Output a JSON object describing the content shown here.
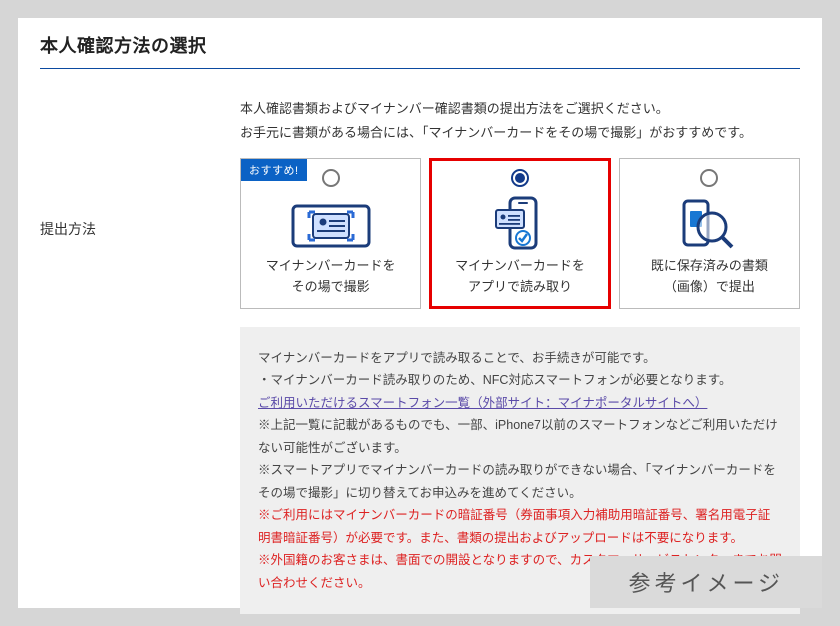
{
  "title": "本人確認方法の選択",
  "instructions": {
    "line1": "本人確認書類およびマイナンバー確認書類の提出方法をご選択ください。",
    "line2": "お手元に書類がある場合には、「マイナンバーカードをその場で撮影」がおすすめです。"
  },
  "label_submit_method": "提出方法",
  "badge_recommended": "おすすめ!",
  "cards": [
    {
      "line1": "マイナンバーカードを",
      "line2": "その場で撮影"
    },
    {
      "line1": "マイナンバーカードを",
      "line2": "アプリで読み取り"
    },
    {
      "line1": "既に保存済みの書類",
      "line2": "（画像）で提出"
    }
  ],
  "info": {
    "head": "マイナンバーカードをアプリで読み取ることで、お手続きが可能です。",
    "b1": "・マイナンバーカード読み取りのため、NFC対応スマートフォンが必要となります。",
    "link": "ご利用いただけるスマートフォン一覧（外部サイト：マイナポータルサイトへ）",
    "b2": "※上記一覧に記載があるものでも、一部、iPhone7以前のスマートフォンなどご利用いただけない可能性がございます。",
    "b3": "※スマートアプリでマイナンバーカードの読み取りができない場合、「マイナンバーカードをその場で撮影」に切り替えてお申込みを進めてください。",
    "r1": "※ご利用にはマイナンバーカードの暗証番号（券面事項入力補助用暗証番号、署名用電子証明書暗証番号）が必要です。また、書類の提出およびアップロードは不要になります。",
    "r2": "※外国籍のお客さまは、書面での開設となりますので、カスタマーサービスセンターまでお問い合わせください。"
  },
  "reference_label": "参考イメージ"
}
